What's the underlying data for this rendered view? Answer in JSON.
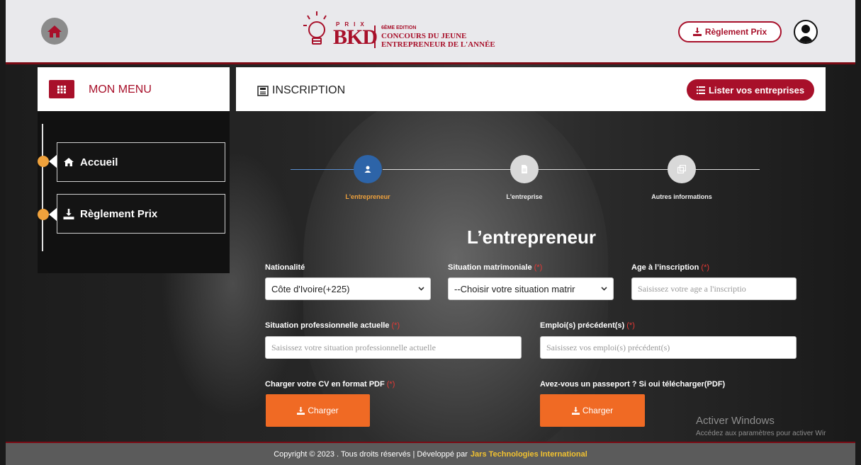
{
  "header": {
    "logo": {
      "prix": "PRIX",
      "brand": "BKD",
      "edition": "6ÈME EDITION",
      "line1": "CONCOURS DU JEUNE",
      "line2": "ENTREPRENEUR DE L'ANNÉE"
    },
    "rules_button": "Règlement Prix"
  },
  "menu": {
    "title": "MON MENU",
    "items": [
      {
        "label": "Accueil",
        "icon": "home-icon"
      },
      {
        "label": "Règlement Prix",
        "icon": "download-icon"
      }
    ]
  },
  "main": {
    "title": "INSCRIPTION",
    "list_button": "Lister vos entreprises",
    "steps": [
      {
        "label": "L'entrepreneur",
        "active": true,
        "icon": "user-icon"
      },
      {
        "label": "L'entreprise",
        "active": false,
        "icon": "document-icon"
      },
      {
        "label": "Autres informations",
        "active": false,
        "icon": "copy-icon"
      }
    ],
    "section_title": "L’entrepreneur",
    "form": {
      "nationality": {
        "label": "Nationalité",
        "value": "Côte d'Ivoire(+225)"
      },
      "marital": {
        "label": "Situation matrimoniale",
        "required": "(*)",
        "value": "--Choisir votre situation matrir"
      },
      "age": {
        "label": "Age à l’inscription",
        "required": "(*)",
        "placeholder": "Saisissez votre age a l'inscriptio"
      },
      "professional": {
        "label": "Situation professionnelle actuelle",
        "required": "(*)",
        "placeholder": "Saisissez votre situation professionnelle actuelle"
      },
      "previous_jobs": {
        "label": "Emploi(s) précédent(s)",
        "required": "(*)",
        "placeholder": "Saisissez vos emploi(s) précédent(s)"
      },
      "cv": {
        "label": "Charger votre CV en format PDF",
        "required": "(*)",
        "button": "Charger"
      },
      "passport": {
        "label": "Avez-vous un passeport ? Si oui télécharger(PDF)",
        "button": "Charger"
      }
    }
  },
  "watermark": {
    "title": "Activer Windows",
    "subtitle": "Accédez aux paramètres pour activer Wir"
  },
  "footer": {
    "text": "Copyright © 2023 . Tous droits réservés | Développé par",
    "company": "Jars Technologies International"
  },
  "colors": {
    "brand_red": "#a8102a",
    "orange": "#f06a24",
    "step_active": "#2d64a8",
    "dot": "#f0a23c"
  }
}
